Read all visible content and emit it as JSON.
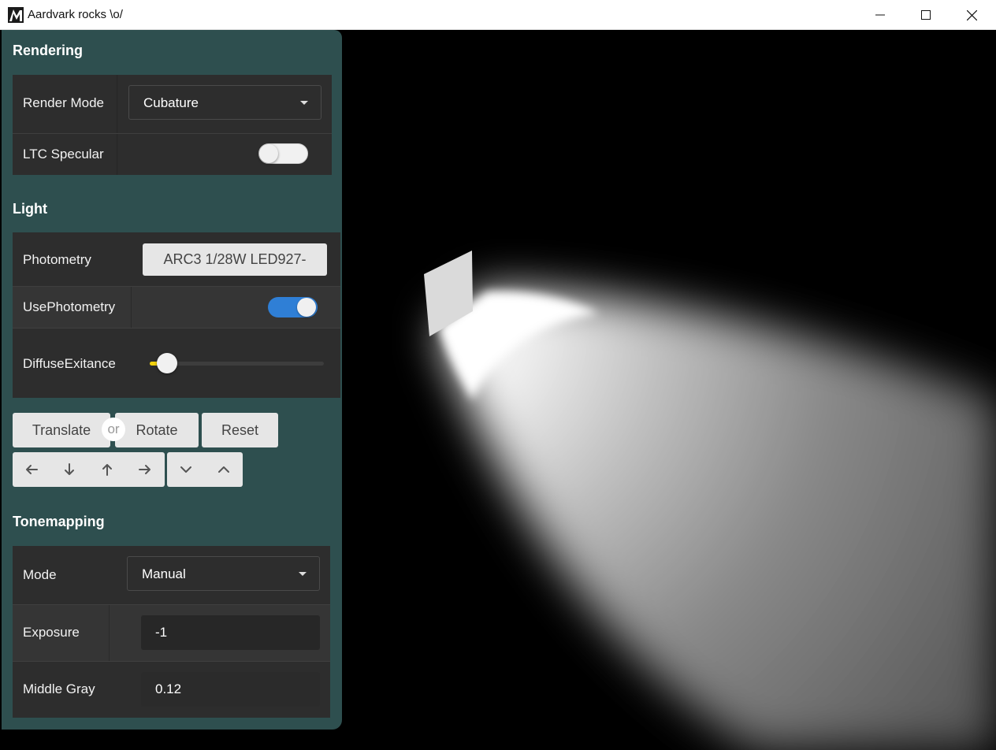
{
  "window": {
    "title": "Aardvark rocks \\o/",
    "controls": [
      "minimize-icon",
      "maximize-icon",
      "close-icon"
    ]
  },
  "rendering": {
    "title": "Rendering",
    "render_mode_label": "Render Mode",
    "render_mode_value": "Cubature",
    "ltc_specular_label": "LTC Specular",
    "ltc_specular_on": false
  },
  "light": {
    "title": "Light",
    "photometry_label": "Photometry",
    "photometry_value": "ARC3 1/28W LED927-",
    "use_photometry_label": "UsePhotometry",
    "use_photometry_on": true,
    "diffuse_exitance_label": "DiffuseExitance",
    "diffuse_exitance_fraction": 0.1
  },
  "transform": {
    "translate_label": "Translate",
    "or_label": "or",
    "rotate_label": "Rotate",
    "reset_label": "Reset",
    "move_icons": [
      "arrow-left-icon",
      "arrow-down-icon",
      "arrow-up-icon",
      "arrow-right-icon"
    ],
    "vertical_icons": [
      "chevron-down-icon",
      "chevron-up-icon"
    ]
  },
  "tonemapping": {
    "title": "Tonemapping",
    "mode_label": "Mode",
    "mode_value": "Manual",
    "exposure_label": "Exposure",
    "exposure_value": "-1",
    "middle_gray_label": "Middle Gray",
    "middle_gray_value": "0.12"
  },
  "colors": {
    "panel_bg": "#2e4f4f",
    "row_bg": "#2d2d2d",
    "toggle_on": "#2f7fd6",
    "slider_fill": "#f3d20e"
  }
}
